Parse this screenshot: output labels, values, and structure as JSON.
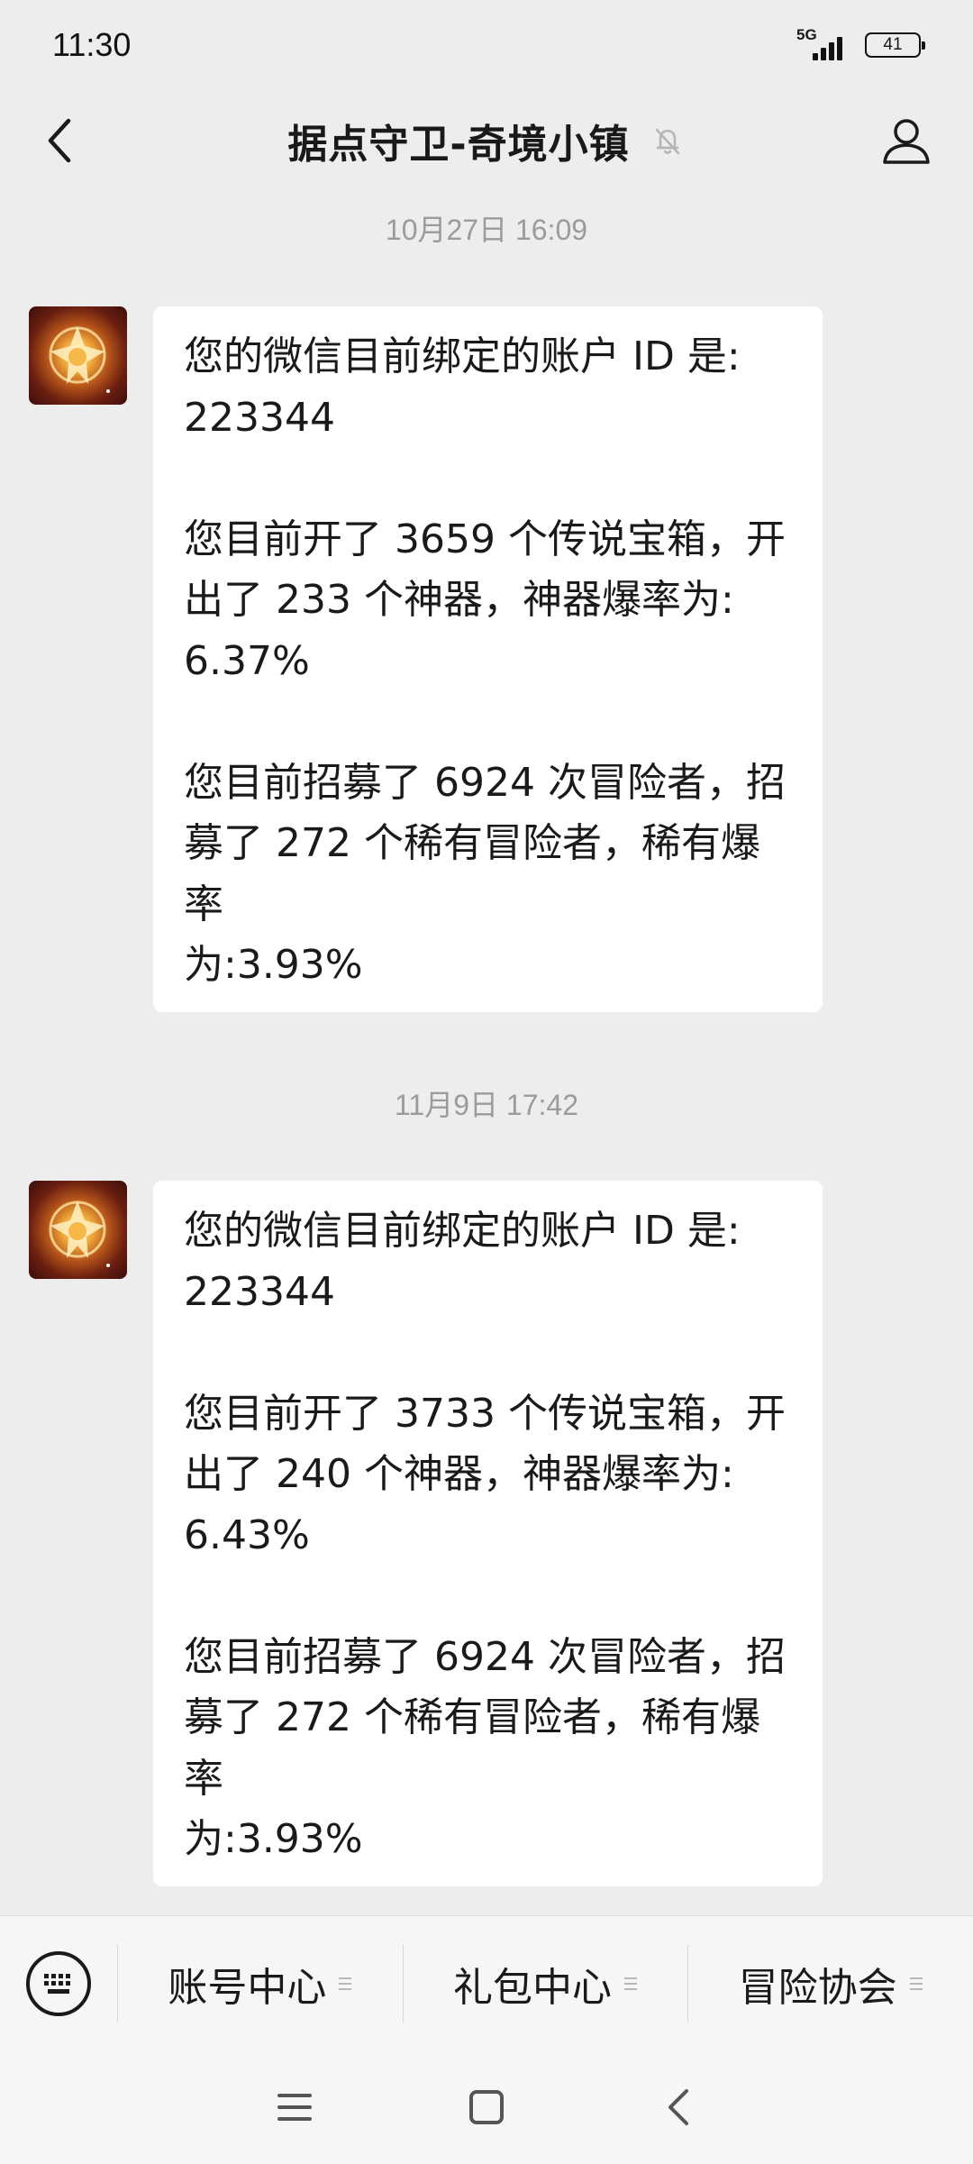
{
  "status_bar": {
    "time": "11:30",
    "network": "5G",
    "battery": "41"
  },
  "header": {
    "title": "据点守卫-奇境小镇",
    "back_icon": "chevron-left-icon",
    "mute_icon": "bell-off-icon",
    "profile_icon": "user-icon"
  },
  "messages": [
    {
      "timestamp": "10月27日 16:09",
      "lines": [
        "您的微信目前绑定的账户 ID 是:",
        "223344",
        "",
        "您目前开了 3659 个传说宝箱，开",
        "出了 233 个神器，神器爆率为:",
        "6.37%",
        "",
        "您目前招募了 6924 次冒险者，招",
        "募了 272 个稀有冒险者，稀有爆率",
        "为:3.93%",
        ""
      ]
    },
    {
      "timestamp": "11月9日 17:42",
      "lines": [
        "您的微信目前绑定的账户 ID 是:",
        "223344",
        "",
        "您目前开了 3733 个传说宝箱，开",
        "出了 240 个神器，神器爆率为:",
        "6.43%",
        "",
        "您目前招募了 6924 次冒险者，招",
        "募了 272 个稀有冒险者，稀有爆率",
        "为:3.93%",
        ""
      ]
    }
  ],
  "menu": {
    "keyboard_icon": "keyboard-icon",
    "items": [
      {
        "label": "账号中心"
      },
      {
        "label": "礼包中心"
      },
      {
        "label": "冒险协会"
      }
    ]
  },
  "nav": {
    "icons": [
      "menu-icon",
      "home-icon",
      "back-icon"
    ]
  }
}
